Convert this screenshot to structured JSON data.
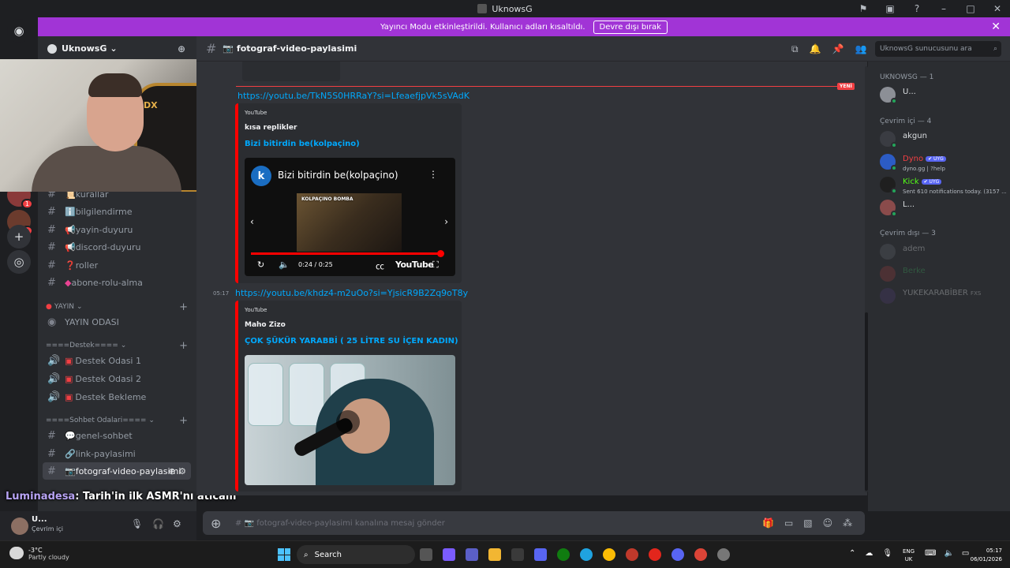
{
  "window": {
    "title": "UknowsG"
  },
  "banner": {
    "text": "Yayıncı Modu etkinleştirildi. Kullanıcı adları kısaltıldı.",
    "button": "Devre dışı bırak"
  },
  "guilds": {
    "badges": [
      "1",
      "1"
    ]
  },
  "server": {
    "name": "UknowsG"
  },
  "channels": {
    "top": [
      {
        "icon": "📜",
        "name": "kurallar"
      },
      {
        "icon": "ℹ️",
        "name": "bilgilendirme"
      },
      {
        "icon": "📢",
        "name": "yayin-duyuru"
      },
      {
        "icon": "📢",
        "name": "discord-duyuru"
      },
      {
        "icon": "❓",
        "name": "roller"
      },
      {
        "icon": "◆",
        "name": "abone-rolu-alma"
      }
    ],
    "cat_yayin": "YAYIN",
    "yayin_odasi": "YAYIN ODASI",
    "cat_destek": "====Destek====",
    "destek": [
      "Destek Odasi 1",
      "Destek Odasi 2",
      "Destek Bekleme"
    ],
    "cat_sohbet": "====Sohbet Odalari====",
    "sohbet": [
      {
        "icon": "💬",
        "name": "genel-sohbet"
      },
      {
        "icon": "🔗",
        "name": "link-paylasimi"
      },
      {
        "icon": "📷",
        "name": "fotograf-video-paylasimi"
      }
    ]
  },
  "overlay": {
    "name": "Luminadesa",
    "text": ": Tarih'in ilk ASMR'nı atıcam"
  },
  "user": {
    "name": "U...",
    "status": "Çevrim içi"
  },
  "chat": {
    "channel": "📷 fotograf-video-paylasimi",
    "search_placeholder": "UknowsG sunucusunu ara",
    "new_label": "YENİ",
    "messages": [
      {
        "link": "https://youtu.be/TkN5S0HRRaY?si=LfeaefjpVk5sVAdK",
        "provider": "YouTube",
        "author": "kısa replikler",
        "title": "Bizi bitirdin be(kolpaçino)",
        "player_initial": "k",
        "player_title": "Bizi bitirdin be(kolpaçino)",
        "thumb_tag": "KOLPAÇINO BOMBA",
        "time": "0:24 / 0:25",
        "progress": 0.96
      },
      {
        "timestamp": "05:17",
        "link": "https://youtu.be/khdz4-m2uOo?si=YjsicR9B2Zq9oT8y",
        "provider": "YouTube",
        "author": "Maho Zizo",
        "title": "ÇOK ŞÜKÜR YARABBİ ( 25 LİTRE SU İÇEN KADIN)"
      }
    ],
    "composer_placeholder": "# 📷 fotograf-video-paylasimi kanalına mesaj gönder"
  },
  "members": {
    "cat_owner": "UKNOWSG — 1",
    "owner": "U...",
    "cat_online": "Çevrim içi — 4",
    "online": [
      {
        "name": "akgun",
        "sub": "",
        "bot": "",
        "color": "#dbdee1"
      },
      {
        "name": "Dyno",
        "sub": "dyno.gg | ?help",
        "bot": "✔ UYG",
        "color": "#f23f43"
      },
      {
        "name": "Kick",
        "sub": "Sent 610 notifications today. (3157 ...",
        "bot": "✔ UYG",
        "color": "#53fc18"
      },
      {
        "name": "L...",
        "sub": "",
        "bot": "",
        "color": "#dbdee1"
      }
    ],
    "cat_offline": "Çevrim dışı — 3",
    "offline": [
      {
        "name": "adem",
        "color": "#dbdee1",
        "tag": ""
      },
      {
        "name": "Berke",
        "color": "#3ba55c",
        "tag": ""
      },
      {
        "name": "YUKEKARABİBER",
        "color": "#dbdee1",
        "tag": "FXS"
      }
    ]
  },
  "taskbar": {
    "weather_temp": "-3°C",
    "weather_desc": "Partly cloudy",
    "search": "Search",
    "lang1": "ENG",
    "lang2": "UK",
    "time": "05:17",
    "date": "06/01/2026"
  }
}
